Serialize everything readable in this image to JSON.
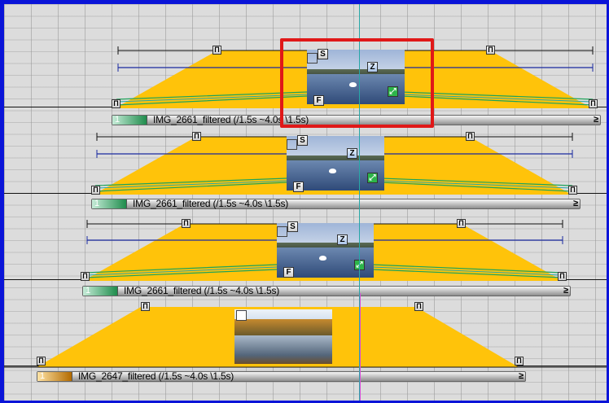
{
  "colors": {
    "frame_border": "#0a14d8",
    "background": "#dcdcdc",
    "clip_fill": "#ffc30a",
    "lane_line": "#111111",
    "timeline_blue": "#1a2aa0",
    "keyframe_green": "#1fa35a",
    "playhead": "#27a7a7",
    "selection": "#e01818"
  },
  "clips": [
    {
      "number": "1",
      "name": "IMG_2661_filtered (/1.5s ~4.0s \\1.5s)",
      "end_marker": "≥",
      "handles": {
        "start": "S",
        "zoom": "Z",
        "finish": "F"
      },
      "thumbnail": "swan-lake-icon",
      "selected": true
    },
    {
      "number": "1",
      "name": "IMG_2661_filtered (/1.5s ~4.0s \\1.5s)",
      "end_marker": "≥",
      "handles": {
        "start": "S",
        "zoom": "Z",
        "finish": "F"
      },
      "thumbnail": "swan-lake-icon",
      "selected": false
    },
    {
      "number": "1",
      "name": "IMG_2661_filtered (/1.5s ~4.0s \\1.5s)",
      "end_marker": "≥",
      "handles": {
        "start": "S",
        "zoom": "Z",
        "finish": "F"
      },
      "thumbnail": "swan-lake-icon",
      "selected": false
    },
    {
      "number": "1",
      "name": "IMG_2647_filtered (/1.5s ~4.0s \\1.5s)",
      "end_marker": "≥",
      "thumbnail": "autumn-river-icon",
      "selected": false
    }
  ]
}
